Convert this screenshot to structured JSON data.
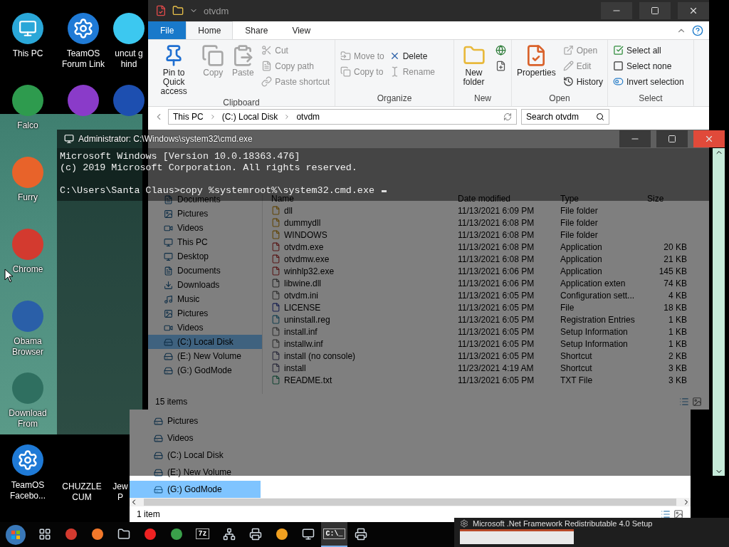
{
  "desktop": {
    "columns": [
      {
        "icons": [
          {
            "kind": "pc",
            "label": "This PC"
          },
          {
            "kind": "recycle",
            "label": "Falco"
          },
          {
            "kind": "fox",
            "label": "Furry"
          },
          {
            "kind": "chrome",
            "label": "Chrome"
          },
          {
            "kind": "obama",
            "label": "Obama Browser"
          },
          {
            "kind": "wave",
            "label": "Download From"
          },
          {
            "kind": "gear",
            "label": "TeamOS Facebo..."
          }
        ]
      },
      {
        "icons": [
          {
            "kind": "gear",
            "label": "TeamOS Forum Link"
          },
          {
            "kind": "wizard"
          }
        ]
      },
      {
        "icons": [
          {
            "kind": "gem",
            "label": "uncut g hind"
          },
          {
            "kind": "two"
          }
        ]
      }
    ],
    "bottom_labels": [
      "CHUZZLE CUM",
      "Jew P"
    ]
  },
  "explorer": {
    "title": "otvdm",
    "tabs": [
      {
        "label": "File",
        "kind": "file",
        "selected": false
      },
      {
        "label": "Home",
        "kind": "tab",
        "selected": true
      },
      {
        "label": "Share",
        "kind": "tab",
        "selected": false
      },
      {
        "label": "View",
        "kind": "tab",
        "selected": false
      }
    ],
    "groups": [
      {
        "name": "Clipboard",
        "large": [
          {
            "label": "Pin to Quick access",
            "kind": "pin",
            "disabled": false
          },
          {
            "label": "Copy",
            "kind": "copy",
            "disabled": true
          },
          {
            "label": "Paste",
            "kind": "paste",
            "disabled": true
          }
        ],
        "small": [
          {
            "label": "Cut",
            "kind": "cut",
            "disabled": true
          },
          {
            "label": "Copy path",
            "kind": "path",
            "disabled": true
          },
          {
            "label": "Paste shortcut",
            "kind": "shortcut",
            "disabled": true
          }
        ]
      },
      {
        "name": "Organize",
        "small": [
          {
            "label": "Move to",
            "kind": "move",
            "disabled": true
          },
          {
            "label": "Copy to",
            "kind": "copyto",
            "disabled": true
          },
          {
            "label": "Delete",
            "kind": "delete",
            "disabled": false
          },
          {
            "label": "Rename",
            "kind": "rename",
            "disabled": true
          }
        ]
      },
      {
        "name": "New",
        "large": [
          {
            "label": "New folder",
            "kind": "folder",
            "disabled": false
          }
        ],
        "small": [
          {
            "kind": "globe",
            "disabled": false
          },
          {
            "kind": "newitem",
            "disabled": false
          }
        ]
      },
      {
        "name": "Open",
        "large": [
          {
            "label": "Properties",
            "kind": "properties",
            "disabled": false
          }
        ],
        "small": [
          {
            "label": "Open",
            "kind": "open",
            "disabled": true
          },
          {
            "label": "Edit",
            "kind": "edit",
            "disabled": true
          },
          {
            "label": "History",
            "kind": "history",
            "disabled": false
          }
        ]
      },
      {
        "name": "Select",
        "small": [
          {
            "label": "Select all",
            "kind": "selectall",
            "disabled": false
          },
          {
            "label": "Select none",
            "kind": "selectnone",
            "disabled": false
          },
          {
            "label": "Invert selection",
            "kind": "invert",
            "disabled": false
          }
        ]
      }
    ],
    "breadcrumbs": [
      "This PC",
      "(C:) Local Disk",
      "otvdm"
    ],
    "search": {
      "placeholder": "Search otvdm"
    },
    "nav": [
      {
        "label": "Documents",
        "kind": "docs",
        "selected": false
      },
      {
        "label": "Pictures",
        "kind": "pics",
        "selected": false
      },
      {
        "label": "Videos",
        "kind": "videos",
        "selected": false
      },
      {
        "label": "This PC",
        "kind": "pc",
        "selected": false
      },
      {
        "label": "Desktop",
        "kind": "desktop",
        "selected": false
      },
      {
        "label": "Documents",
        "kind": "docs",
        "selected": false
      },
      {
        "label": "Downloads",
        "kind": "downloads",
        "selected": false
      },
      {
        "label": "Music",
        "kind": "music",
        "selected": false
      },
      {
        "label": "Pictures",
        "kind": "pics",
        "selected": false
      },
      {
        "label": "Videos",
        "kind": "videos",
        "selected": false
      },
      {
        "label": "(C:) Local Disk",
        "kind": "disk",
        "selected": true
      },
      {
        "label": "(E:) New Volume",
        "kind": "disk",
        "selected": false
      },
      {
        "label": "(G:) GodMode",
        "kind": "disk",
        "selected": false
      }
    ],
    "columns": [
      "Name",
      "Date modified",
      "Type",
      "Size"
    ],
    "files": [
      {
        "name": "dll",
        "date": "11/13/2021 6:09 PM",
        "type": "File folder",
        "kind": "folder"
      },
      {
        "name": "dummydll",
        "date": "11/13/2021 6:08 PM",
        "type": "File folder",
        "kind": "folder"
      },
      {
        "name": "WINDOWS",
        "date": "11/13/2021 6:08 PM",
        "type": "File folder",
        "kind": "folder"
      },
      {
        "name": "otvdm.exe",
        "date": "11/13/2021 6:08 PM",
        "type": "Application",
        "size": "20 KB",
        "kind": "app"
      },
      {
        "name": "otvdmw.exe",
        "date": "11/13/2021 6:08 PM",
        "type": "Application",
        "size": "21 KB",
        "kind": "app"
      },
      {
        "name": "winhlp32.exe",
        "date": "11/13/2021 6:06 PM",
        "type": "Application",
        "size": "145 KB",
        "kind": "app"
      },
      {
        "name": "libwine.dll",
        "date": "11/13/2021 6:06 PM",
        "type": "Application exten",
        "size": "74 KB",
        "kind": "dll"
      },
      {
        "name": "otvdm.ini",
        "date": "11/13/2021 6:05 PM",
        "type": "Configuration sett...",
        "size": "4 KB",
        "kind": "ini"
      },
      {
        "name": "LICENSE",
        "date": "11/13/2021 6:05 PM",
        "type": "File",
        "size": "18 KB",
        "kind": "file"
      },
      {
        "name": "uninstall.reg",
        "date": "11/13/2021 6:05 PM",
        "type": "Registration Entries",
        "size": "1 KB",
        "kind": "reg"
      },
      {
        "name": "install.inf",
        "date": "11/13/2021 6:05 PM",
        "type": "Setup Information",
        "size": "1 KB",
        "kind": "ini"
      },
      {
        "name": "installw.inf",
        "date": "11/13/2021 6:05 PM",
        "type": "Setup Information",
        "size": "1 KB",
        "kind": "ini"
      },
      {
        "name": "install (no console)",
        "date": "11/13/2021 6:05 PM",
        "type": "Shortcut",
        "size": "2 KB",
        "kind": "shortcut"
      },
      {
        "name": "install",
        "date": "11/23/2021 4:19 AM",
        "type": "Shortcut",
        "size": "3 KB",
        "kind": "shortcut"
      },
      {
        "name": "README.txt",
        "date": "11/13/2021 6:05 PM",
        "type": "TXT File",
        "size": "3 KB",
        "kind": "txt"
      }
    ],
    "status": "15 items"
  },
  "explorer2": {
    "nav": [
      {
        "label": "Pictures",
        "selected": false
      },
      {
        "label": "Videos",
        "selected": false
      },
      {
        "label": "(C:) Local Disk",
        "selected": false
      },
      {
        "label": "(E:) New Volume",
        "selected": false
      },
      {
        "label": "(G:) GodMode",
        "selected": true
      }
    ],
    "status": "1 item"
  },
  "cmd": {
    "title": "Administrator: C:\\Windows\\system32\\cmd.exe",
    "output": [
      "Microsoft Windows [Version 10.0.18363.476]",
      "(c) 2019 Microsoft Corporation. All rights reserved."
    ],
    "prompt": "C:\\Users\\Santa Claus>copy %systemroot%\\system32.cmd.exe"
  },
  "taskbar": {
    "items": [
      {
        "kind": "taskview",
        "selected": false
      },
      {
        "kind": "chrome",
        "selected": false
      },
      {
        "kind": "firefox",
        "selected": false
      },
      {
        "kind": "explorer",
        "selected": false
      },
      {
        "kind": "yandex",
        "selected": false
      },
      {
        "kind": "ie",
        "selected": false
      },
      {
        "kind": "sevenzip",
        "glyph": "7z",
        "selected": false
      },
      {
        "kind": "network",
        "selected": false
      },
      {
        "kind": "printer",
        "selected": false
      },
      {
        "kind": "lambda",
        "selected": false
      },
      {
        "kind": "monitor",
        "selected": false
      },
      {
        "kind": "cmd",
        "glyph": "C:\\_",
        "selected": true
      },
      {
        "kind": "printer",
        "selected": false
      }
    ],
    "preview": {
      "title": "Microsoft .Net Framework Redistributable 4.0 Setup"
    }
  }
}
